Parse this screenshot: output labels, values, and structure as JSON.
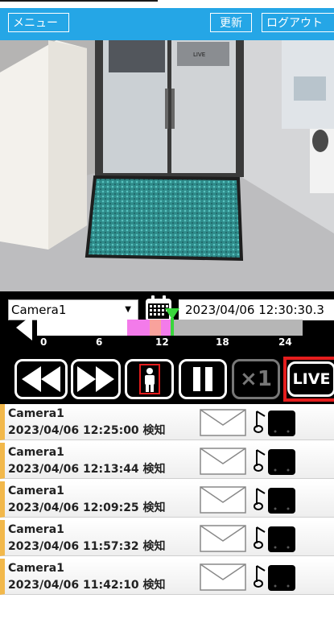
{
  "header": {
    "menu_label": "メニュー",
    "refresh_label": "更新",
    "logout_label": "ログアウト"
  },
  "camera_view": {
    "sign_text": "LIVE"
  },
  "controls": {
    "camera_select": "Camera1",
    "datetime": "2023/04/06 12:30:30.3",
    "timeline_ticks": [
      "0",
      "6",
      "12",
      "18",
      "24"
    ],
    "speed_label": "×1",
    "live_label": "LIVE"
  },
  "events": [
    {
      "camera": "Camera1",
      "time": "2023/04/06 12:25:00 検知"
    },
    {
      "camera": "Camera1",
      "time": "2023/04/06 12:13:44 検知"
    },
    {
      "camera": "Camera1",
      "time": "2023/04/06 12:09:25 検知"
    },
    {
      "camera": "Camera1",
      "time": "2023/04/06 11:57:32 検知"
    },
    {
      "camera": "Camera1",
      "time": "2023/04/06 11:42:10 検知"
    }
  ],
  "colors": {
    "header": "#25a6e6",
    "event_accent": "#f2b84b",
    "live_border": "#e51d1d",
    "timeline_pink": "#f37bea",
    "timeline_marker": "#39d63c"
  }
}
